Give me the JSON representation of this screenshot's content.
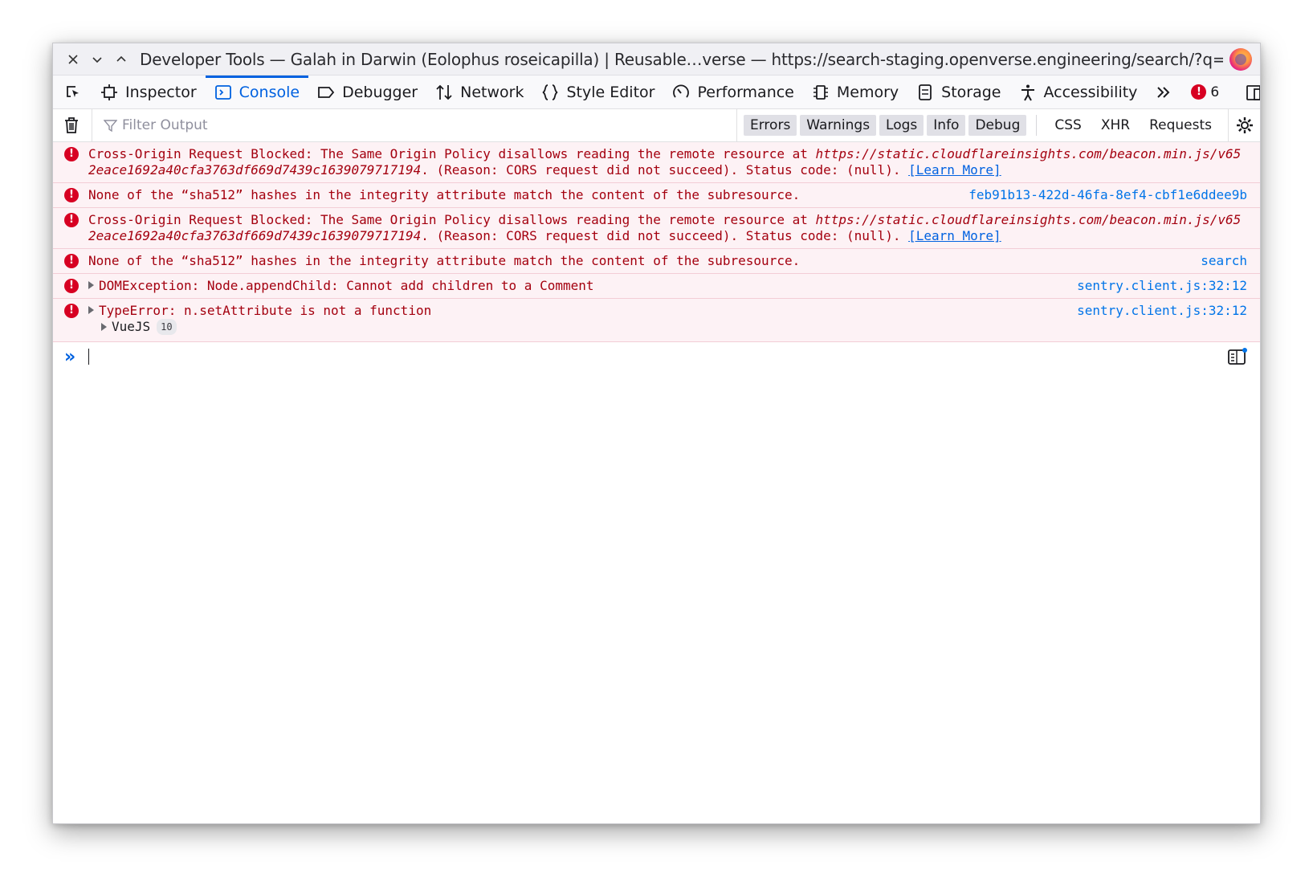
{
  "window": {
    "title": "Developer Tools — Galah in Darwin (Eolophus roseicapilla) | Reusable…verse — https://search-staging.openverse.engineering/search/?q=galah"
  },
  "toolbar": {
    "tools": [
      {
        "label": "Inspector",
        "icon": "inspector-icon"
      },
      {
        "label": "Console",
        "icon": "console-icon",
        "active": true
      },
      {
        "label": "Debugger",
        "icon": "debugger-icon"
      },
      {
        "label": "Network",
        "icon": "network-icon"
      },
      {
        "label": "Style Editor",
        "icon": "style-editor-icon"
      },
      {
        "label": "Performance",
        "icon": "performance-icon"
      },
      {
        "label": "Memory",
        "icon": "memory-icon"
      },
      {
        "label": "Storage",
        "icon": "storage-icon"
      },
      {
        "label": "Accessibility",
        "icon": "accessibility-icon"
      }
    ],
    "error_count": "6"
  },
  "filter": {
    "placeholder": "Filter Output",
    "levels": [
      "Errors",
      "Warnings",
      "Logs",
      "Info",
      "Debug"
    ],
    "types": [
      "CSS",
      "XHR",
      "Requests"
    ]
  },
  "messages": [
    {
      "text": "Cross-Origin Request Blocked: The Same Origin Policy disallows reading the remote resource at ",
      "url": "https://static.cloudflareinsights.com/beacon.min.js/v652eace1692a40cfa3763df669d7439c1639079717194",
      "text2": ". (Reason: CORS request did not succeed). Status code: (null). ",
      "learn_more": "[Learn More]",
      "source": ""
    },
    {
      "text": "None of the “sha512” hashes in the integrity attribute match the content of the subresource.",
      "source": "feb91b13-422d-46fa-8ef4-cbf1e6ddee9b"
    },
    {
      "text": "Cross-Origin Request Blocked: The Same Origin Policy disallows reading the remote resource at ",
      "url": "https://static.cloudflareinsights.com/beacon.min.js/v652eace1692a40cfa3763df669d7439c1639079717194",
      "text2": ". (Reason: CORS request did not succeed). Status code: (null). ",
      "learn_more": "[Learn More]",
      "source": ""
    },
    {
      "text": "None of the “sha512” hashes in the integrity attribute match the content of the subresource.",
      "source": "search"
    },
    {
      "text": "DOMException: Node.appendChild: Cannot add children to a Comment",
      "source_file": "sentry.client.js",
      "source_loc": ":32:12"
    },
    {
      "text": "TypeError: n.setAttribute is not a function",
      "source_file": "sentry.client.js",
      "source_loc": ":32:12",
      "child": {
        "label": "VueJS",
        "count": "10"
      }
    }
  ],
  "colors": {
    "accent": "#0061e0",
    "error_bg": "#fdf2f5",
    "error_text": "#a4000f",
    "error_icon": "#d70022"
  }
}
